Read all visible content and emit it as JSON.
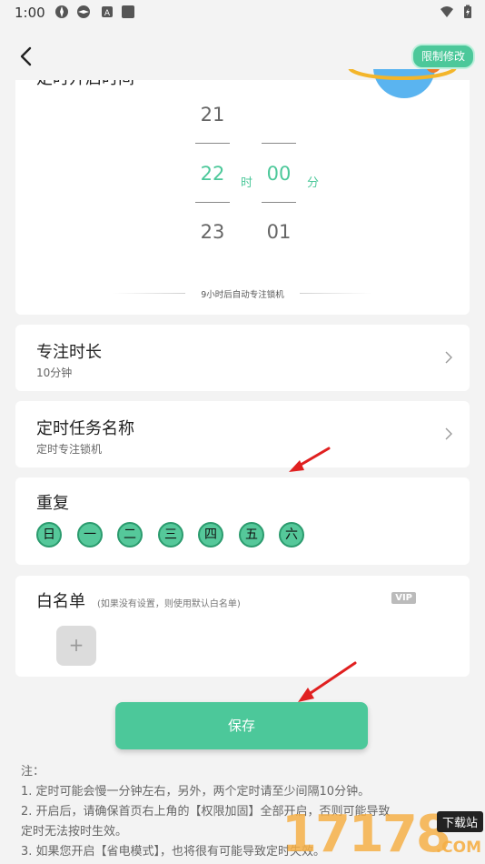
{
  "status": {
    "time": "1:00"
  },
  "header": {
    "limit_label": "限制修改"
  },
  "timer": {
    "title": "定时开启时间",
    "hours": [
      "21",
      "22",
      "23"
    ],
    "minutes": [
      "00",
      "01"
    ],
    "hour_unit": "时",
    "minute_unit": "分",
    "hint": "9小时后自动专注锁机"
  },
  "focus_duration": {
    "title": "专注时长",
    "value": "10分钟"
  },
  "task_name": {
    "title": "定时任务名称",
    "value": "定时专注锁机"
  },
  "repeat": {
    "title": "重复",
    "days": [
      "日",
      "一",
      "二",
      "三",
      "四",
      "五",
      "六"
    ],
    "selected_color": "#55c89a"
  },
  "whitelist": {
    "title": "白名单",
    "note": "(如果没有设置，则使用默认白名单)",
    "badge": "VIP",
    "add_label": "+"
  },
  "save_label": "保存",
  "notes": {
    "heading": "注：",
    "items": [
      "1. 定时可能会慢一分钟左右，另外，两个定时请至少间隔10分钟。",
      "2. 开启后，请确保首页右上角的【权限加固】全部开启，否则可能导致",
      "定时无法按时生效。",
      "3. 如果您开启【省电模式】，也将很有可能导致定时失效。"
    ]
  },
  "watermark": {
    "text": "17178",
    "badge": "下载站",
    "domain": ".COM"
  },
  "colors": {
    "accent": "#4cc89a",
    "background": "#f3f3f3",
    "card": "#ffffff",
    "arrow": "#e02020"
  }
}
